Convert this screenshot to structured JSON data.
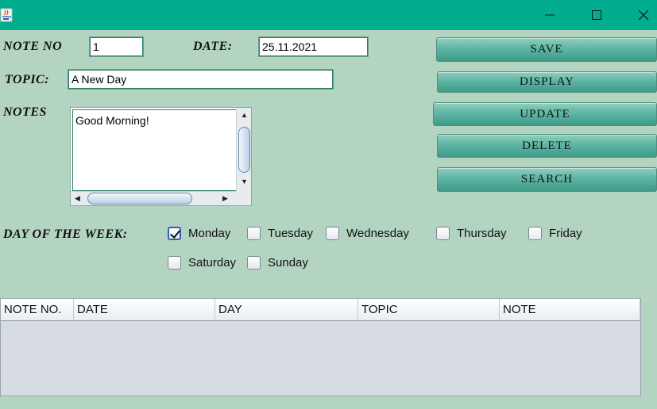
{
  "window": {
    "controls": {
      "minimize_icon": "minimize-icon",
      "maximize_icon": "maximize-icon",
      "close_icon": "close-icon"
    },
    "colors": {
      "titlebar": "#00ad8f",
      "background": "#b3d4c1",
      "button": "#5fb5a3",
      "table_body": "#d7dbe2"
    }
  },
  "form": {
    "note_no_label": "NOTE NO",
    "note_no_value": "1",
    "date_label": "DATE:",
    "date_value": "25.11.2021",
    "topic_label": "TOPIC:",
    "topic_value": "A New Day",
    "notes_label": "NOTES",
    "notes_value": "Good Morning!",
    "day_label": "DAY OF THE WEEK:"
  },
  "days": [
    {
      "label": "Monday",
      "checked": true
    },
    {
      "label": "Tuesday",
      "checked": false
    },
    {
      "label": "Wednesday",
      "checked": false
    },
    {
      "label": "Thursday",
      "checked": false
    },
    {
      "label": "Friday",
      "checked": false
    },
    {
      "label": "Saturday",
      "checked": false
    },
    {
      "label": "Sunday",
      "checked": false
    }
  ],
  "buttons": {
    "save": "SAVE",
    "display": "DISPLAY",
    "update": "UPDATE",
    "delete": "DELETE",
    "search": "SEARCH"
  },
  "table": {
    "columns": [
      "NOTE NO.",
      "DATE",
      "DAY",
      "TOPIC",
      "NOTE"
    ],
    "rows": []
  }
}
